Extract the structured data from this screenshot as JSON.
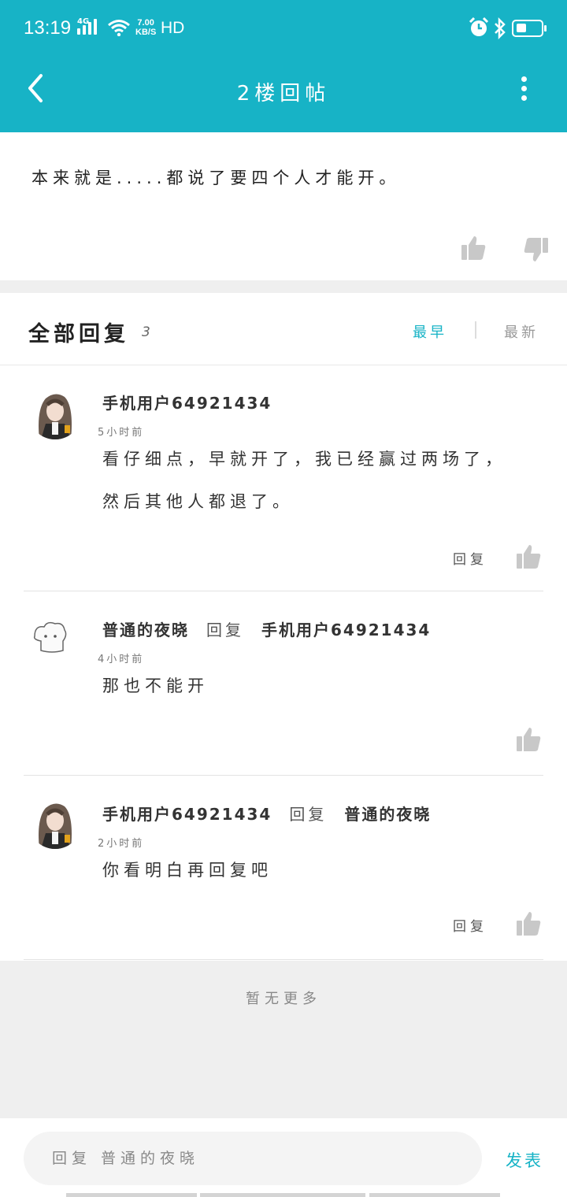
{
  "status_bar": {
    "time": "13:19",
    "network": "4G",
    "speed_value": "7.00",
    "speed_unit": "KB/S",
    "hd": "HD"
  },
  "header": {
    "title": "2楼回帖"
  },
  "post": {
    "text": "本来就是.....都说了要四个人才能开。"
  },
  "replies": {
    "title": "全部回复",
    "count": "3",
    "sort_earliest": "最早",
    "sort_newest": "最新",
    "items": [
      {
        "user": "手机用户64921434",
        "time": "5小时前",
        "content": "看仔细点，早就开了，我已经赢过两场了，然后其他人都退了。",
        "reply_label": "回复"
      },
      {
        "user": "普通的夜晓",
        "reply_word": "回复",
        "target": "手机用户64921434",
        "time": "4小时前",
        "content": "那也不能开"
      },
      {
        "user": "手机用户64921434",
        "reply_word": "回复",
        "target": "普通的夜晓",
        "time": "2小时前",
        "content": "你看明白再回复吧",
        "reply_label": "回复"
      }
    ],
    "no_more": "暂无更多"
  },
  "bottom_bar": {
    "input_placeholder": "回复 普通的夜晓",
    "send_label": "发表"
  },
  "colors": {
    "accent": "#17b3c6",
    "background": "#efefef"
  },
  "icons": [
    "back-arrow-icon",
    "more-vertical-icon",
    "thumbs-up-icon",
    "thumbs-down-icon",
    "wifi-icon",
    "alarm-icon",
    "bluetooth-icon",
    "battery-icon"
  ]
}
